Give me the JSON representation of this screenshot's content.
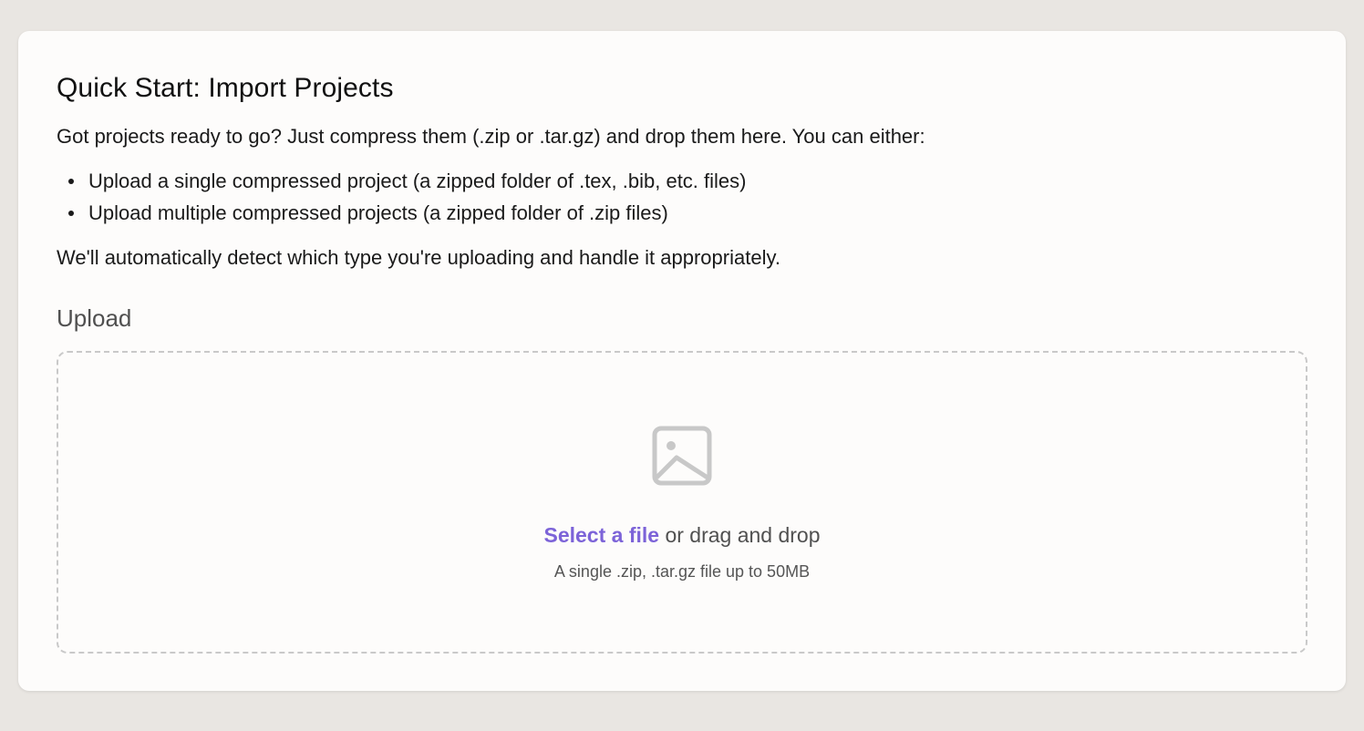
{
  "card": {
    "title": "Quick Start: Import Projects",
    "intro": "Got projects ready to go? Just compress them (.zip or .tar.gz) and drop them here. You can either:",
    "bullets": [
      "Upload a single compressed project (a zipped folder of .tex, .bib, etc. files)",
      "Upload multiple compressed projects (a zipped folder of .zip files)"
    ],
    "outro": "We'll automatically detect which type you're uploading and handle it appropriately."
  },
  "upload": {
    "heading": "Upload",
    "icon": "image-icon",
    "select_label": "Select a file",
    "drag_text": " or drag and drop",
    "limit_text": "A single .zip, .tar.gz file up to 50MB"
  },
  "colors": {
    "background": "#e9e6e2",
    "card": "#fdfcfb",
    "accent": "#7c63d8",
    "dropzone_border": "#c9c9c9",
    "icon": "#c8c8c8"
  }
}
